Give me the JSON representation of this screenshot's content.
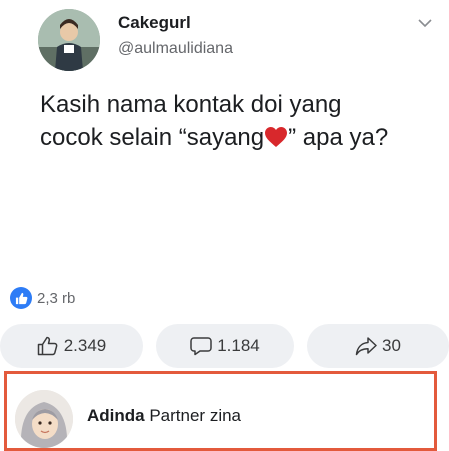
{
  "post": {
    "author_name": "Cakegurl",
    "author_handle": "@aulmaulidiana",
    "text_line1": "Kasih nama kontak doi yang",
    "text_line2_before": "cocok selain “sayang",
    "text_line2_after": "” apa ya?",
    "emoji": "red-heart"
  },
  "reactions": {
    "summary_count": "2,3 rb",
    "icon": "thumbs-up-icon"
  },
  "actions": {
    "like_count": "2.349",
    "comment_count": "1.184",
    "share_count": "30"
  },
  "comment": {
    "author": "Adinda",
    "text": "Partner zina"
  },
  "colors": {
    "accent_blue": "#2d7cf6",
    "highlight_border": "#e35a3c",
    "heart_red": "#d8282c"
  }
}
